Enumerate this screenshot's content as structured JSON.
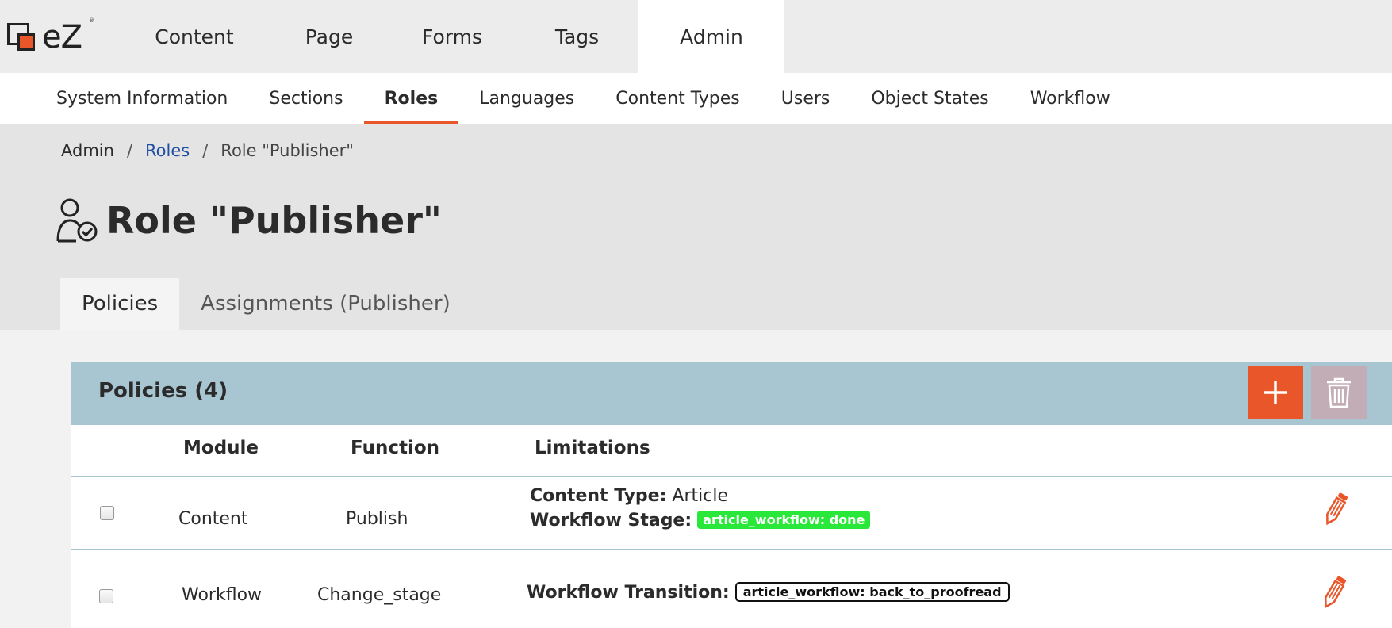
{
  "logo": {
    "text": "eZ",
    "mark": "®"
  },
  "top_nav": [
    {
      "label": "Content",
      "active": false
    },
    {
      "label": "Page",
      "active": false
    },
    {
      "label": "Forms",
      "active": false
    },
    {
      "label": "Tags",
      "active": false
    },
    {
      "label": "Admin",
      "active": true
    }
  ],
  "sub_nav": [
    {
      "label": "System Information",
      "active": false
    },
    {
      "label": "Sections",
      "active": false
    },
    {
      "label": "Roles",
      "active": true
    },
    {
      "label": "Languages",
      "active": false
    },
    {
      "label": "Content Types",
      "active": false
    },
    {
      "label": "Users",
      "active": false
    },
    {
      "label": "Object States",
      "active": false
    },
    {
      "label": "Workflow",
      "active": false
    }
  ],
  "breadcrumb": {
    "root": "Admin",
    "link": "Roles",
    "current": "Role \"Publisher\"",
    "separator": "/"
  },
  "page": {
    "title": "Role \"Publisher\"",
    "icon": "user-role-icon"
  },
  "tabs": [
    {
      "label": "Policies",
      "active": true
    },
    {
      "label": "Assignments (Publisher)",
      "active": false
    }
  ],
  "policies": {
    "title": "Policies (4)",
    "add_icon": "plus-icon",
    "delete_icon": "trash-icon",
    "columns": {
      "module": "Module",
      "function": "Function",
      "limitations": "Limitations"
    },
    "rows": [
      {
        "module": "Content",
        "function": "Publish",
        "limitations": [
          {
            "label": "Content Type:",
            "value": "Article"
          },
          {
            "label": "Workflow Stage:",
            "badge": "article_workflow: done"
          }
        ]
      },
      {
        "module": "Workflow",
        "function": "Change_stage",
        "limitations": [
          {
            "label": "Workflow Transition:",
            "badge": "article_workflow: back_to_proofread"
          }
        ]
      }
    ]
  },
  "colors": {
    "accent": "#e8562a",
    "panel_header": "#a8c6d2",
    "badge_green": "#2ae83a",
    "link": "#1f4ea3"
  }
}
